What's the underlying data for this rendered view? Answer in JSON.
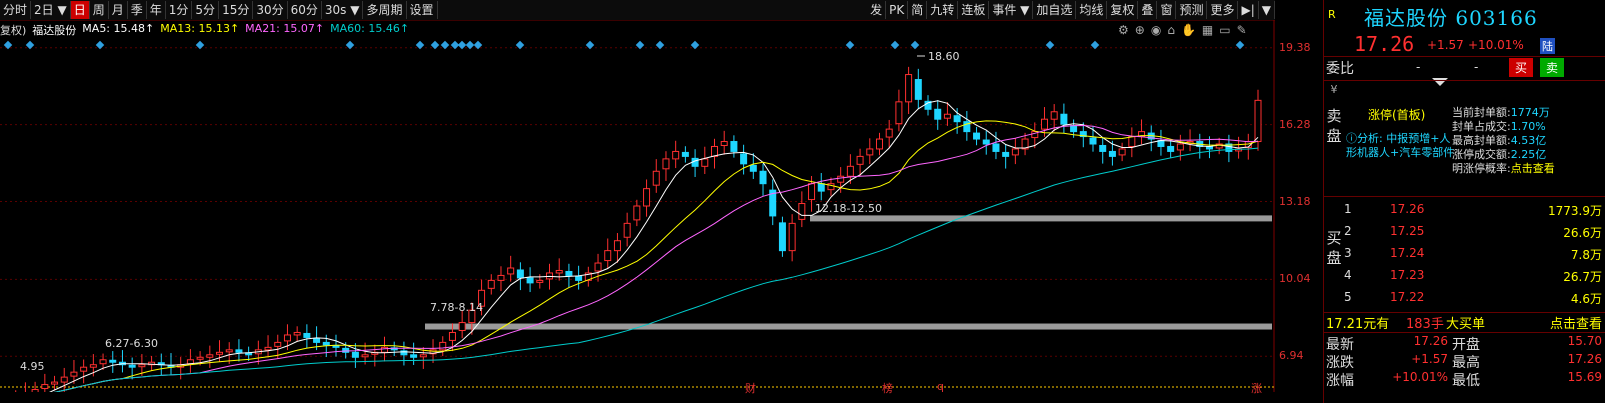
{
  "toolbar": {
    "left_items": [
      "分时",
      "2日 ▼",
      "日",
      "周",
      "月",
      "季",
      "年",
      "1分",
      "5分",
      "15分",
      "30分",
      "60分",
      "30s ▼",
      "多周期",
      "设置"
    ],
    "active_item": "日",
    "right_items": [
      "发",
      "PK",
      "简",
      "九转",
      "连板",
      "事件 ▼",
      "加自选",
      "均线",
      "复权",
      "叠",
      "窗",
      "预测",
      "更多",
      "▶|",
      "▼"
    ]
  },
  "legend": {
    "fuquan": "复权)",
    "name": "福达股份",
    "ma5": "MA5: 15.48↑",
    "ma13": "MA13: 15.13↑",
    "ma21": "MA21: 15.07↑",
    "ma60": "MA60: 15.46↑"
  },
  "colors": {
    "ma5": "#ffffff",
    "ma13": "#ffff00",
    "ma21": "#ff66ff",
    "ma60": "#00cccc",
    "up": "#ff3030",
    "down": "#1ed6ff"
  },
  "tool_icons": [
    "settings-icon",
    "zoom-icon",
    "eye-icon",
    "shop-icon",
    "hand-icon",
    "grid-icon",
    "screen-icon",
    "brush-icon"
  ],
  "chart_data": {
    "type": "candlestick",
    "ylim": [
      5.5,
      20.5
    ],
    "price_ticks": [
      "19.38",
      "16.28",
      "13.18",
      "10.04",
      "6.94"
    ],
    "price_tick_values": [
      19.38,
      16.28,
      13.18,
      10.04,
      6.94
    ],
    "annotations": {
      "high_label": "18.60",
      "gap1": "12.18-12.50",
      "gap2": "7.78-8.14",
      "gap3": "6.27-6.30",
      "low_label": "4.95"
    },
    "gap_levels": [
      12.5,
      8.14
    ],
    "bottom_marks": [
      "财",
      "榜",
      "q",
      "涨"
    ],
    "close_series": [
      5.0,
      5.2,
      5.4,
      5.6,
      5.8,
      5.9,
      6.1,
      6.3,
      6.5,
      6.6,
      6.8,
      6.7,
      6.6,
      6.5,
      6.6,
      6.7,
      6.6,
      6.5,
      6.6,
      6.8,
      6.9,
      7.0,
      7.1,
      7.2,
      7.1,
      7.0,
      7.2,
      7.3,
      7.5,
      7.8,
      7.9,
      7.7,
      7.5,
      7.4,
      7.3,
      7.1,
      6.9,
      7.0,
      7.1,
      7.3,
      7.2,
      7.0,
      6.9,
      7.0,
      7.2,
      7.5,
      7.9,
      8.3,
      8.8,
      9.6,
      10.0,
      10.2,
      10.5,
      10.1,
      9.9,
      10.0,
      10.3,
      10.4,
      10.2,
      10.0,
      10.3,
      10.7,
      11.2,
      11.6,
      12.3,
      13.0,
      13.7,
      14.4,
      14.9,
      15.2,
      15.0,
      14.6,
      14.9,
      15.4,
      15.6,
      15.2,
      14.7,
      14.4,
      13.9,
      12.6,
      11.2,
      12.3,
      13.1,
      13.9,
      13.6,
      13.9,
      14.2,
      14.6,
      15.0,
      15.3,
      15.7,
      16.1,
      17.2,
      18.3,
      17.3,
      16.9,
      16.5,
      16.7,
      16.4,
      16.0,
      15.7,
      15.5,
      15.2,
      15.0,
      15.3,
      15.7,
      16.0,
      16.5,
      16.8,
      16.3,
      16.0,
      15.8,
      15.5,
      15.2,
      15.0,
      15.3,
      15.8,
      16.0,
      15.7,
      15.4,
      15.2,
      15.5,
      15.6,
      15.4,
      15.3,
      15.5,
      15.2,
      15.3,
      15.6,
      17.26
    ]
  },
  "panel": {
    "r_badge": "R",
    "stock_name": "福达股份 603166",
    "price": "17.26",
    "change": "+1.57",
    "change_pct": "+10.01%",
    "lu_badge": "陆",
    "weibi_label": "委比",
    "weibi_value": "-",
    "weibi_value2": "-",
    "buy_button": "买",
    "sell_button": "卖",
    "sell_label_top": "¥",
    "sell_label": "卖盘",
    "zt_title": "涨停(首板)",
    "zt_analysis": "ⓘ分析: 中报预增+人形机器人+汽车零部件",
    "zt_info": [
      {
        "k": "当前封单额:",
        "v": "1774万"
      },
      {
        "k": "封单占成交:",
        "v": "1.70%"
      },
      {
        "k": "最高封单额:",
        "v": "4.53亿"
      },
      {
        "k": "涨停成交额:",
        "v": "2.25亿"
      },
      {
        "k": "明涨停概率:",
        "v": "点击查看"
      }
    ],
    "buy_label": "买盘",
    "buy_levels": [
      {
        "lvl": "1",
        "price": "17.26",
        "vol": "1773.9万"
      },
      {
        "lvl": "2",
        "price": "17.25",
        "vol": "26.6万"
      },
      {
        "lvl": "3",
        "price": "17.24",
        "vol": "7.8万"
      },
      {
        "lvl": "4",
        "price": "17.23",
        "vol": "26.7万"
      },
      {
        "lvl": "5",
        "price": "17.22",
        "vol": "4.6万"
      }
    ],
    "bigorder": {
      "price": "17.21元有",
      "qty": "183手",
      "label": "大买单",
      "link": "点击查看"
    },
    "quote": [
      {
        "k1": "最新",
        "v1": "17.26",
        "k2": "开盘",
        "v2": "15.70"
      },
      {
        "k1": "涨跌",
        "v1": "+1.57",
        "k2": "最高",
        "v2": "17.26"
      },
      {
        "k1": "涨幅",
        "v1": "+10.01%",
        "k2": "最低",
        "v2": "15.69"
      }
    ]
  }
}
